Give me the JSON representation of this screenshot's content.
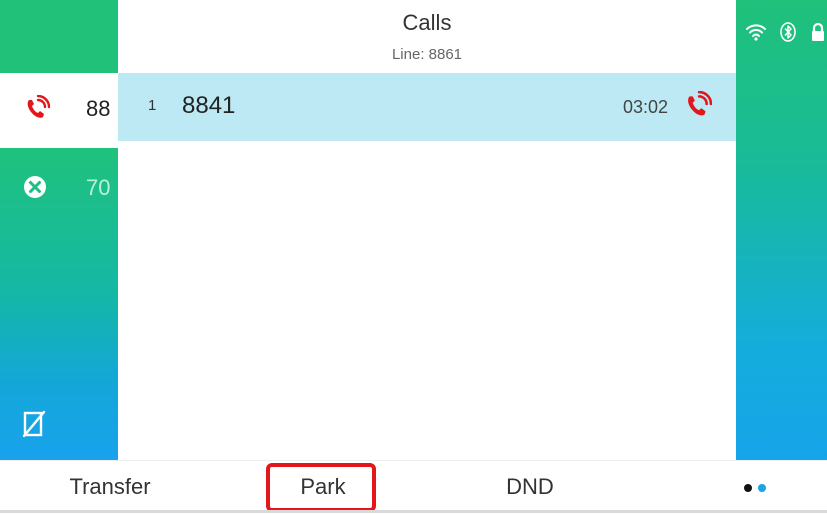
{
  "header": {
    "title": "Calls",
    "subtitle": "Line: 8861"
  },
  "line_keys": [
    {
      "label": "88",
      "icon": "phone-ringing-icon",
      "state": "active"
    },
    {
      "label": "70",
      "icon": "cross-circle-icon",
      "state": "unavailable"
    },
    {
      "label": "",
      "icon": "no-line-icon",
      "state": "none"
    }
  ],
  "calls": [
    {
      "index": "1",
      "number": "8841",
      "duration": "03:02",
      "icon": "phone-ringing-icon"
    }
  ],
  "status_bar": {
    "icons": [
      "wifi-icon",
      "bluetooth-icon",
      "lock-icon"
    ]
  },
  "softkeys": {
    "transfer": "Transfer",
    "park": "Park",
    "dnd": "DND",
    "more_icon": "more-dots-icon"
  },
  "colors": {
    "accent_green": "#21c17a",
    "accent_blue": "#18a2ec",
    "call_row_bg": "#bde9f4",
    "alert_red": "#e2161b",
    "highlight_red": "#e2161b"
  }
}
